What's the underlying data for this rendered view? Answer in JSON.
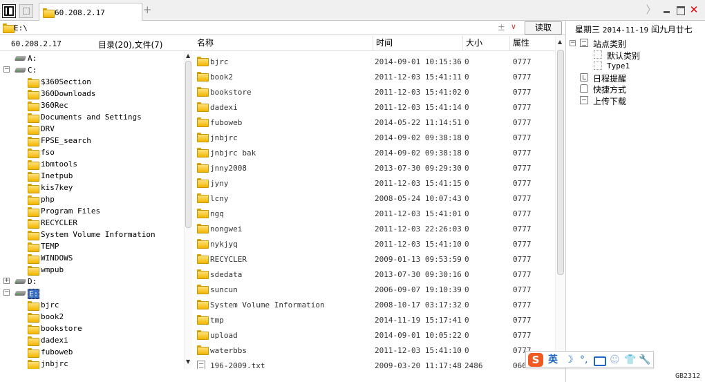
{
  "tabs": {
    "active_title": "60.208.2.17",
    "add_label": "+"
  },
  "window": {
    "next_glyph": "〉",
    "close_glyph": "✕"
  },
  "address": {
    "value": "E:\\",
    "plus_glyph": "±",
    "dropdown_glyph": "∨",
    "read_label": "读取"
  },
  "tree_header": {
    "host": "60.208.2.17",
    "count": "目录(20),文件(7)"
  },
  "tree": {
    "toggle_expanded": "−",
    "toggle_collapsed": "+",
    "rows": [
      {
        "label": "A:",
        "kind": "drive"
      },
      {
        "label": "C:",
        "kind": "drive",
        "toggle": "expanded"
      },
      {
        "label": "$360Section",
        "kind": "folder"
      },
      {
        "label": "360Downloads",
        "kind": "folder"
      },
      {
        "label": "360Rec",
        "kind": "folder"
      },
      {
        "label": "Documents and Settings",
        "kind": "folder"
      },
      {
        "label": "DRV",
        "kind": "folder"
      },
      {
        "label": "FPSE_search",
        "kind": "folder"
      },
      {
        "label": "fso",
        "kind": "folder"
      },
      {
        "label": "ibmtools",
        "kind": "folder"
      },
      {
        "label": "Inetpub",
        "kind": "folder"
      },
      {
        "label": "kis7key",
        "kind": "folder"
      },
      {
        "label": "php",
        "kind": "folder"
      },
      {
        "label": "Program Files",
        "kind": "folder"
      },
      {
        "label": "RECYCLER",
        "kind": "folder"
      },
      {
        "label": "System Volume Information",
        "kind": "folder"
      },
      {
        "label": "TEMP",
        "kind": "folder"
      },
      {
        "label": "WINDOWS",
        "kind": "folder"
      },
      {
        "label": "wmpub",
        "kind": "folder"
      },
      {
        "label": "D:",
        "kind": "drive",
        "toggle": "collapsed"
      },
      {
        "label": "E:",
        "kind": "drive",
        "toggle": "expanded",
        "selected": true
      },
      {
        "label": "bjrc",
        "kind": "folder"
      },
      {
        "label": "book2",
        "kind": "folder"
      },
      {
        "label": "bookstore",
        "kind": "folder"
      },
      {
        "label": "dadexi",
        "kind": "folder"
      },
      {
        "label": "fuboweb",
        "kind": "folder"
      },
      {
        "label": "jnbjrc",
        "kind": "folder"
      }
    ]
  },
  "list": {
    "columns": {
      "name": "名称",
      "time": "时间",
      "size": "大小",
      "attr": "属性"
    },
    "rows": [
      {
        "name": "bjrc",
        "time": "2014-09-01 10:15:36",
        "size": "0",
        "attr": "0777",
        "kind": "folder"
      },
      {
        "name": "book2",
        "time": "2011-12-03 15:41:11",
        "size": "0",
        "attr": "0777",
        "kind": "folder"
      },
      {
        "name": "bookstore",
        "time": "2011-12-03 15:41:02",
        "size": "0",
        "attr": "0777",
        "kind": "folder"
      },
      {
        "name": "dadexi",
        "time": "2011-12-03 15:41:14",
        "size": "0",
        "attr": "0777",
        "kind": "folder"
      },
      {
        "name": "fuboweb",
        "time": "2014-05-22 11:14:51",
        "size": "0",
        "attr": "0777",
        "kind": "folder"
      },
      {
        "name": "jnbjrc",
        "time": "2014-09-02 09:38:18",
        "size": "0",
        "attr": "0777",
        "kind": "folder"
      },
      {
        "name": "jnbjrc bak",
        "time": "2014-09-02 09:38:18",
        "size": "0",
        "attr": "0777",
        "kind": "folder"
      },
      {
        "name": "jnny2008",
        "time": "2013-07-30 09:29:30",
        "size": "0",
        "attr": "0777",
        "kind": "folder"
      },
      {
        "name": "jyny",
        "time": "2011-12-03 15:41:15",
        "size": "0",
        "attr": "0777",
        "kind": "folder"
      },
      {
        "name": "lcny",
        "time": "2008-05-24 10:07:43",
        "size": "0",
        "attr": "0777",
        "kind": "folder"
      },
      {
        "name": "ngq",
        "time": "2011-12-03 15:41:01",
        "size": "0",
        "attr": "0777",
        "kind": "folder"
      },
      {
        "name": "nongwei",
        "time": "2011-12-03 22:26:03",
        "size": "0",
        "attr": "0777",
        "kind": "folder"
      },
      {
        "name": "nykjyq",
        "time": "2011-12-03 15:41:10",
        "size": "0",
        "attr": "0777",
        "kind": "folder"
      },
      {
        "name": "RECYCLER",
        "time": "2009-01-13 09:53:59",
        "size": "0",
        "attr": "0777",
        "kind": "folder"
      },
      {
        "name": "sdedata",
        "time": "2013-07-30 09:30:16",
        "size": "0",
        "attr": "0777",
        "kind": "folder"
      },
      {
        "name": "suncun",
        "time": "2006-09-07 19:10:39",
        "size": "0",
        "attr": "0777",
        "kind": "folder"
      },
      {
        "name": "System Volume Information",
        "time": "2008-10-17 03:17:32",
        "size": "0",
        "attr": "0777",
        "kind": "folder"
      },
      {
        "name": "tmp",
        "time": "2014-11-19 15:17:41",
        "size": "0",
        "attr": "0777",
        "kind": "folder"
      },
      {
        "name": "upload",
        "time": "2014-09-01 10:05:22",
        "size": "0",
        "attr": "0777",
        "kind": "folder"
      },
      {
        "name": "waterbbs",
        "time": "2011-12-03 15:41:10",
        "size": "0",
        "attr": "0777",
        "kind": "folder"
      },
      {
        "name": "196-2009.txt",
        "time": "2009-03-20 11:17:48",
        "size": "2486",
        "attr": "0666",
        "kind": "file"
      }
    ]
  },
  "right_panel": {
    "weekday": "星期三",
    "date": "2014-11-19",
    "lunar": "闰九月廿七",
    "items": [
      {
        "label": "站点类别",
        "icon": "category-icon",
        "toggle": "−",
        "level": 0
      },
      {
        "label": "默认类别",
        "icon": "subcategory-icon",
        "level": 1
      },
      {
        "label": "Type1",
        "icon": "subcategory-icon",
        "level": 1,
        "mono": true
      },
      {
        "label": "日程提醒",
        "icon": "reminder-icon",
        "level": 0
      },
      {
        "label": "快捷方式",
        "icon": "shortcut-icon",
        "level": 0
      },
      {
        "label": "上传下载",
        "icon": "transfer-icon",
        "level": 0
      }
    ]
  },
  "ime": {
    "logo": "S",
    "lang": "英",
    "moon": "☽",
    "punct": "°,",
    "user": "☺",
    "shirt": "👕",
    "tool": "🔧"
  },
  "status": {
    "encoding": "GB2312"
  }
}
